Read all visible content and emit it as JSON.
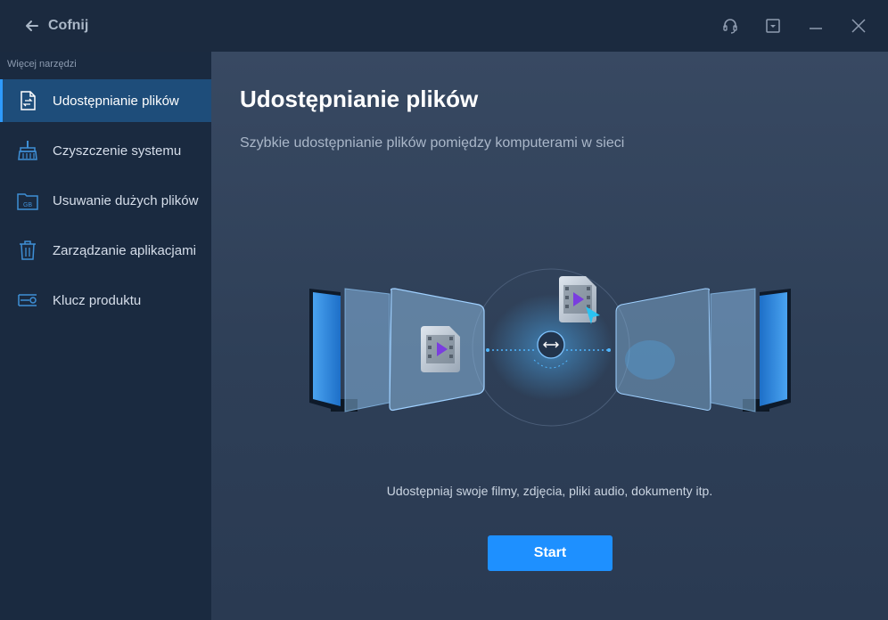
{
  "titlebar": {
    "back_label": "Cofnij",
    "icons": [
      "headset-icon",
      "menu-dropdown-icon",
      "minimize-icon",
      "close-icon"
    ]
  },
  "sidebar": {
    "heading": "Więcej narzędzi",
    "items": [
      {
        "label": "Udostępnianie plików",
        "icon": "file-share-icon",
        "active": true
      },
      {
        "label": "Czyszczenie systemu",
        "icon": "broom-icon",
        "active": false
      },
      {
        "label": "Usuwanie dużych plików",
        "icon": "gb-folder-icon",
        "active": false
      },
      {
        "label": "Zarządzanie aplikacjami",
        "icon": "trash-icon",
        "active": false
      },
      {
        "label": "Klucz produktu",
        "icon": "key-icon",
        "active": false
      }
    ]
  },
  "main": {
    "title": "Udostępnianie plików",
    "subtitle": "Szybkie udostępnianie plików pomiędzy komputerami w sieci",
    "description": "Udostępniaj swoje filmy, zdjęcia, pliki audio, dokumenty itp.",
    "start_label": "Start"
  },
  "colors": {
    "accent": "#1e90ff",
    "sidebar_active": "#1e4d7a",
    "background": "#1c2b40"
  }
}
